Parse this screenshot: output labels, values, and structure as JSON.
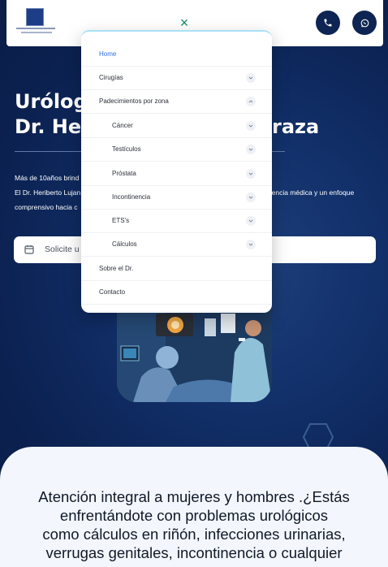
{
  "header": {
    "close_icon": "×",
    "phone_icon": "phone-icon",
    "whatsapp_icon": "whatsapp-icon"
  },
  "hero": {
    "title_line1": "Urólog",
    "title_line1_right": "",
    "title_line2_left": "Dr. Her",
    "title_line2_right": "raza",
    "para_line1": "Más de 10años brind",
    "para_line2_left": "El Dr. Heriberto Lujan",
    "para_line2_right": "elencia médica y un enfoque",
    "para_line3": "comprensivo hacia c",
    "search_placeholder": "Solicite u"
  },
  "menu": {
    "items": [
      {
        "label": "Home",
        "active": true,
        "chevron": false
      },
      {
        "label": "Cirugías",
        "chevron": "down"
      },
      {
        "label": "Padecimientos por zona",
        "chevron": "up"
      },
      {
        "label": "Cáncer",
        "chevron": "down",
        "sub": true
      },
      {
        "label": "Testículos",
        "chevron": "down",
        "sub": true
      },
      {
        "label": "Próstata",
        "chevron": "down",
        "sub": true
      },
      {
        "label": "Incontinencia",
        "chevron": "down",
        "sub": true
      },
      {
        "label": "ETS's",
        "chevron": "down",
        "sub": true
      },
      {
        "label": "Cálculos",
        "chevron": "down",
        "sub": true
      },
      {
        "label": "Sobre el Dr.",
        "chevron": false
      },
      {
        "label": "Contacto",
        "chevron": false
      }
    ]
  },
  "intro": {
    "line1": "Atención integral a mujeres y hombres .¿Estás",
    "line2": "enfrentándote con problemas urológicos",
    "line3": "como cálculos en riñón, infecciones urinarias,",
    "line4": "verrugas genitales, incontinencia o cualquier"
  },
  "colors": {
    "navy": "#0e2452",
    "active_link": "#2f6fe0",
    "close_x": "#1c8b5e"
  }
}
